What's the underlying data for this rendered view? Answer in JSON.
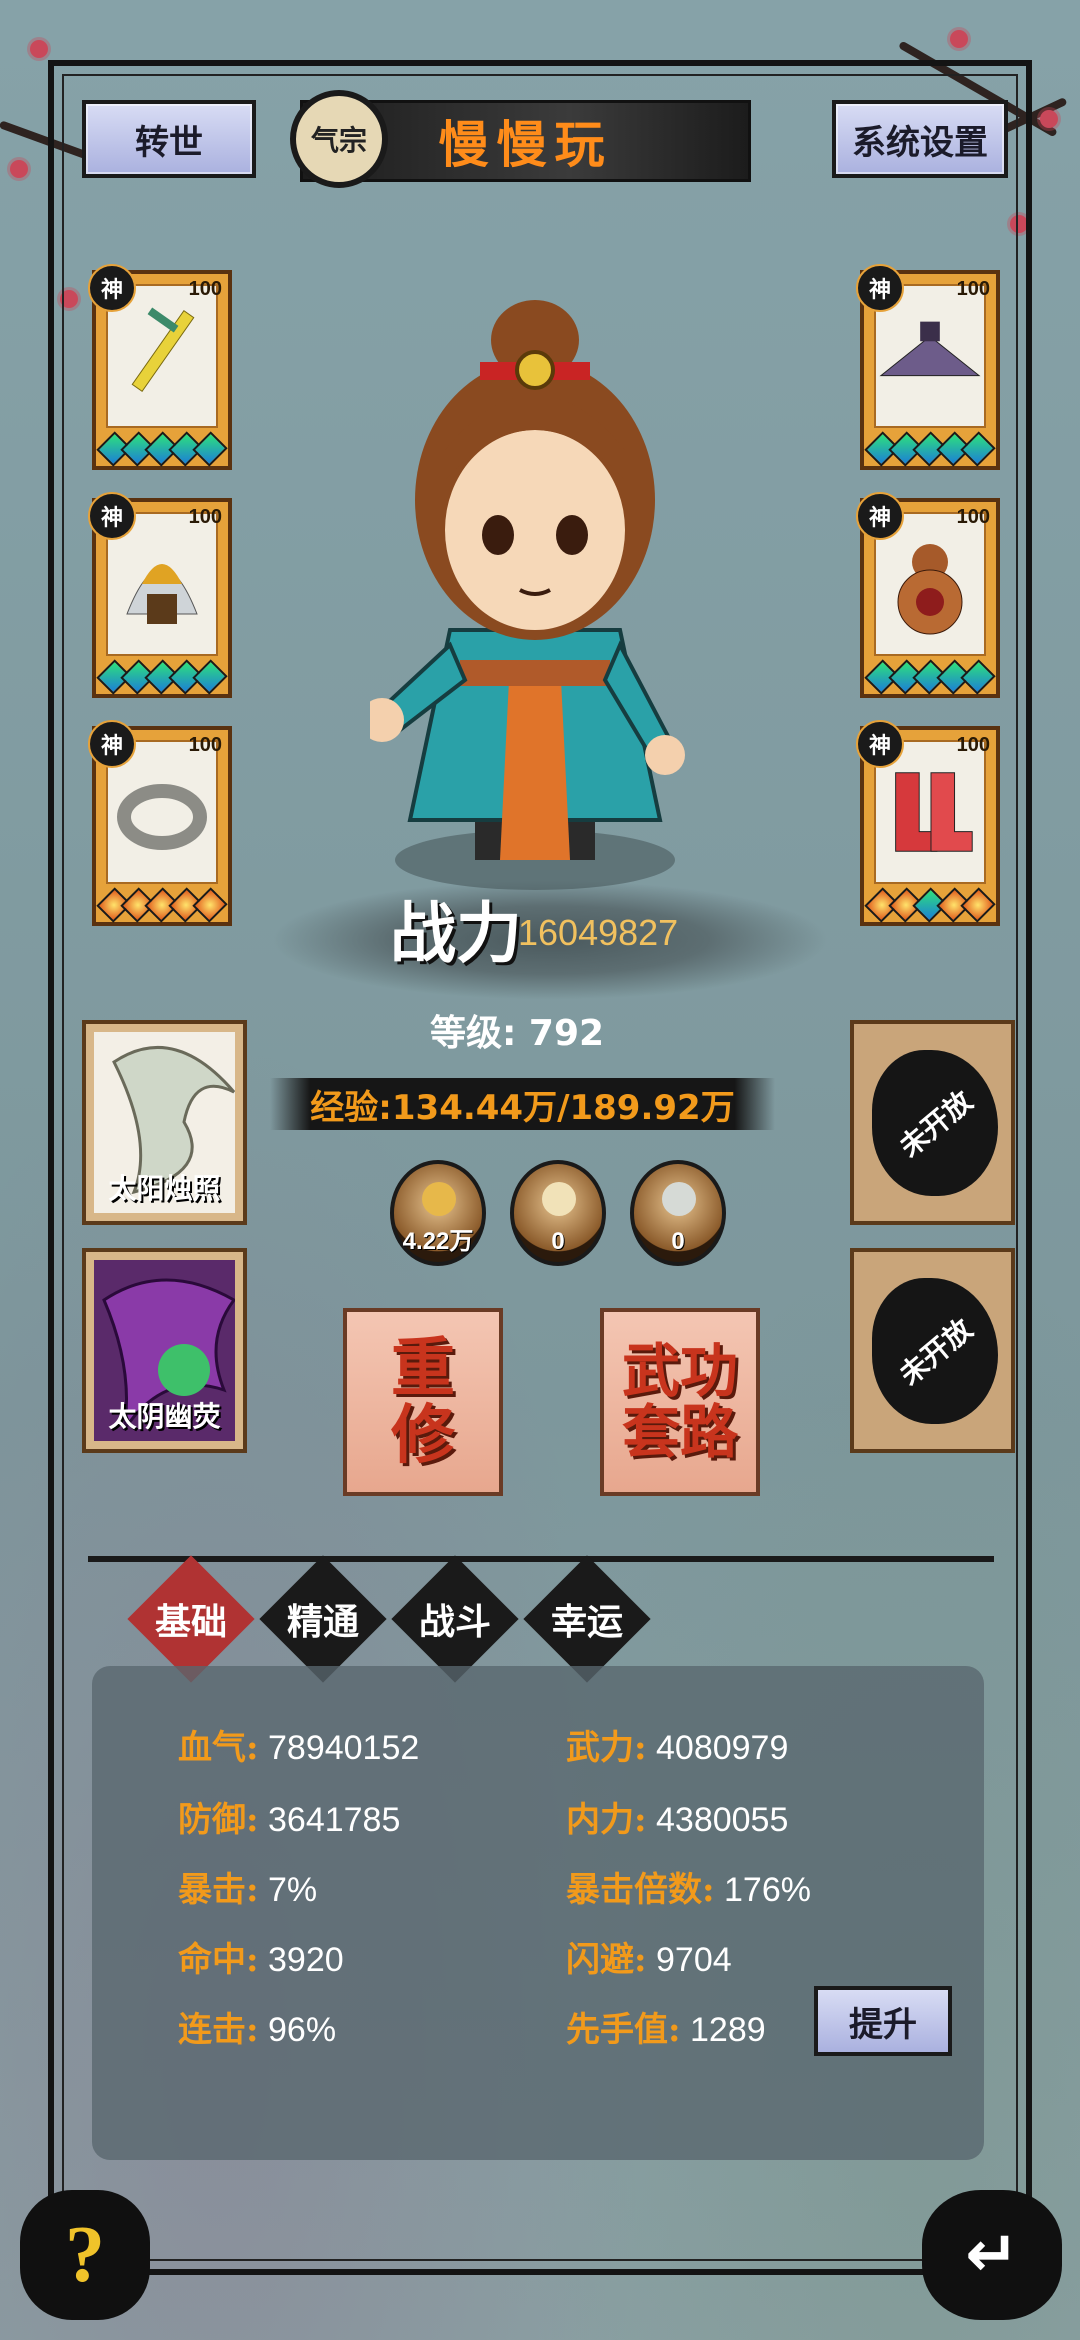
{
  "topbar": {
    "rebirth_label": "转世",
    "sect_badge": "气宗",
    "player_name": "慢慢玩",
    "settings_label": "系统设置"
  },
  "equipment": {
    "left": [
      {
        "grade": "神",
        "level": "100",
        "icon": "sword-icon",
        "gem_style": "gem"
      },
      {
        "grade": "神",
        "level": "100",
        "icon": "helmet-icon",
        "gem_style": "gem"
      },
      {
        "grade": "神",
        "level": "100",
        "icon": "ring-icon",
        "gem_style": "star"
      }
    ],
    "right": [
      {
        "grade": "神",
        "level": "100",
        "icon": "hat-icon",
        "gem_style": "gem"
      },
      {
        "grade": "神",
        "level": "100",
        "icon": "gourd-icon",
        "gem_style": "gem"
      },
      {
        "grade": "神",
        "level": "100",
        "icon": "boots-icon",
        "gem_style": "mixed"
      }
    ]
  },
  "character": {
    "power_label": "战力",
    "power_value": "16049827",
    "level_text": "等级: 792",
    "exp_text": "经验:134.44万/189.92万"
  },
  "skills": [
    {
      "label": "太阳烛照"
    },
    {
      "label": "太阴幽荧"
    }
  ],
  "locked_slots": [
    {
      "label": "未开放"
    },
    {
      "label": "未开放"
    }
  ],
  "currencies": [
    {
      "value": "4.22万",
      "color": "#e7b84a"
    },
    {
      "value": "0",
      "color": "#f1e2b8"
    },
    {
      "value": "0",
      "color": "#d6dad6"
    }
  ],
  "actions": {
    "retrain_label": "重修",
    "martial_label": "武功套路"
  },
  "tabs": [
    {
      "label": "基础",
      "active": true
    },
    {
      "label": "精通",
      "active": false
    },
    {
      "label": "战斗",
      "active": false
    },
    {
      "label": "幸运",
      "active": false
    }
  ],
  "stats": {
    "hp": {
      "key": "血气:",
      "value": "78940152"
    },
    "force": {
      "key": "武力:",
      "value": "4080979"
    },
    "defense": {
      "key": "防御:",
      "value": "3641785"
    },
    "inner": {
      "key": "内力:",
      "value": "4380055"
    },
    "crit": {
      "key": "暴击:",
      "value": "7%"
    },
    "crit_mult": {
      "key": "暴击倍数:",
      "value": "176%"
    },
    "hit": {
      "key": "命中:",
      "value": "3920"
    },
    "dodge": {
      "key": "闪避:",
      "value": "9704"
    },
    "combo": {
      "key": "连击:",
      "value": "96%"
    },
    "initiative": {
      "key": "先手值:",
      "value": "1289"
    },
    "upgrade_label": "提升"
  },
  "bottom": {
    "help_label": "?",
    "back_label": "↵"
  },
  "colors": {
    "accent_orange": "#f29a1b",
    "power_gold": "#f1c15f",
    "tab_active": "#b03333"
  }
}
